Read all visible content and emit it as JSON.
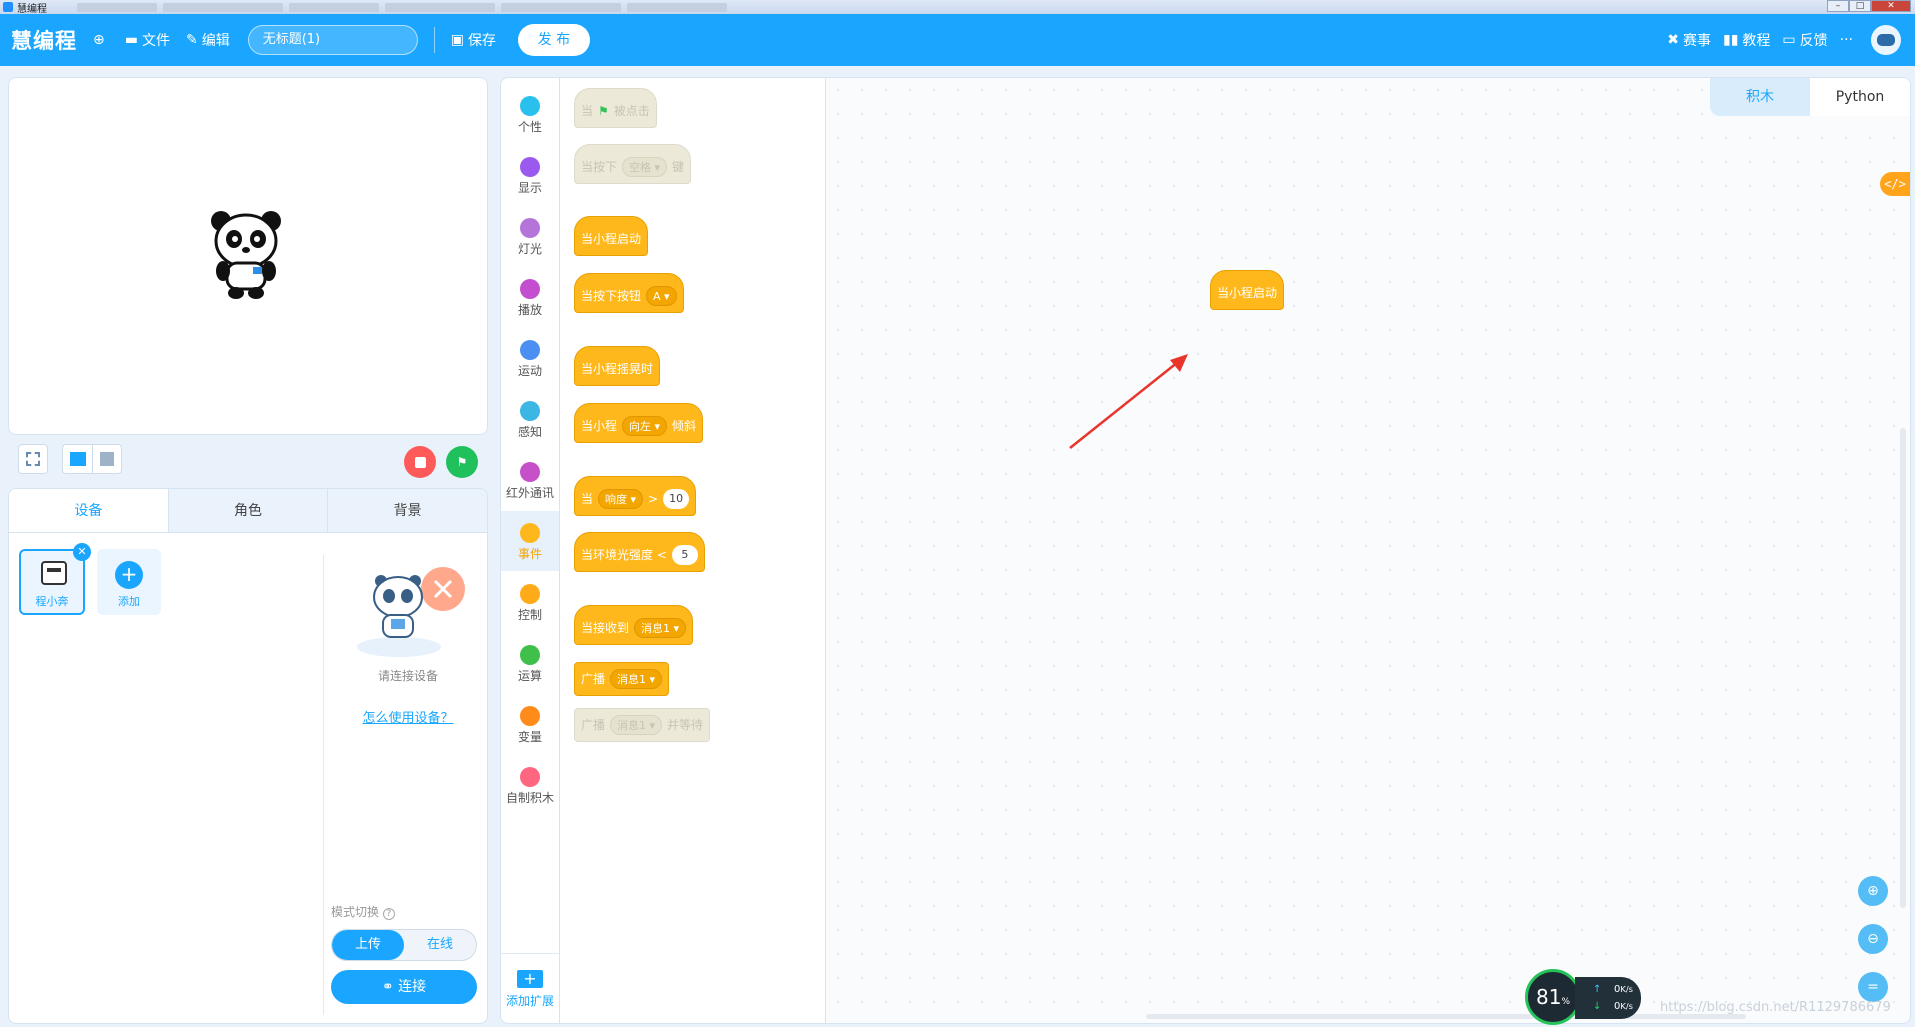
{
  "os": {
    "title": "慧编程"
  },
  "header": {
    "logo": "慧编程",
    "file_label": "文件",
    "edit_label": "编辑",
    "project_name": "无标题(1)",
    "save_label": "保存",
    "publish_label": "发 布",
    "right_items": [
      {
        "icon": "x-events-icon",
        "label": "赛事"
      },
      {
        "icon": "book-icon",
        "label": "教程"
      },
      {
        "icon": "chat-icon",
        "label": "反馈"
      }
    ],
    "more": "···"
  },
  "device_tabs": [
    "设备",
    "角色",
    "背景"
  ],
  "device": {
    "name": "程小奔",
    "add_label": "添加",
    "connect_hint": "请连接设备",
    "howto_link": "怎么使用设备？",
    "mode_label": "模式切换",
    "mode_options": [
      "上传",
      "在线"
    ],
    "connect_label": "连接"
  },
  "categories": [
    {
      "label": "个性",
      "color": "#29c0ee"
    },
    {
      "label": "显示",
      "color": "#9b59f0"
    },
    {
      "label": "灯光",
      "color": "#b574d9"
    },
    {
      "label": "播放",
      "color": "#c34fd0"
    },
    {
      "label": "运动",
      "color": "#4c8ff2"
    },
    {
      "label": "感知",
      "color": "#3cb6e3"
    },
    {
      "label": "红外通讯",
      "color": "#c650c8"
    },
    {
      "label": "事件",
      "color": "#ffb81c"
    },
    {
      "label": "控制",
      "color": "#ffab19"
    },
    {
      "label": "运算",
      "color": "#40bf4a"
    },
    {
      "label": "变量",
      "color": "#ff8c1a"
    },
    {
      "label": "自制积木",
      "color": "#ff6680"
    }
  ],
  "add_extension": "添加扩展",
  "blocks": {
    "b1": {
      "pre": "当",
      "post": "被点击"
    },
    "b2": {
      "pre": "当按下",
      "drop": "空格",
      "post": "键"
    },
    "b3": {
      "text": "当小程启动"
    },
    "b4": {
      "pre": "当按下按钮",
      "drop": "A"
    },
    "b5": {
      "text": "当小程摇晃时"
    },
    "b6": {
      "pre": "当小程",
      "drop": "向左",
      "post": "倾斜"
    },
    "b7": {
      "pre": "当",
      "drop": "响度",
      "op": ">",
      "num": "10"
    },
    "b8": {
      "pre": "当环境光强度 <",
      "num": "5"
    },
    "b9": {
      "pre": "当接收到",
      "drop": "消息1"
    },
    "b10": {
      "pre": "广播",
      "drop": "消息1"
    },
    "b11": {
      "pre": "广播",
      "drop": "消息1",
      "post": "并等待"
    }
  },
  "workspace": {
    "tabs": [
      "积木",
      "Python"
    ],
    "code_toggle": "</>",
    "placed_block": "当小程启动"
  },
  "speed": {
    "percent": "81",
    "percent_unit": "%",
    "up": "0",
    "down": "0",
    "unit": "K/s"
  },
  "watermark": "https://blog.csdn.net/R1129786679"
}
